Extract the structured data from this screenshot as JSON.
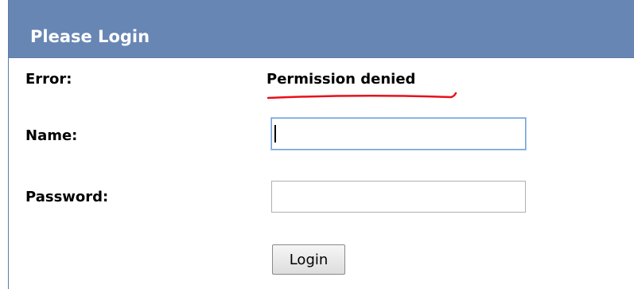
{
  "login_panel": {
    "title": "Please Login",
    "error": {
      "label": "Error:",
      "message": "Permission denied"
    },
    "name": {
      "label": "Name:",
      "value": ""
    },
    "password": {
      "label": "Password:",
      "value": ""
    },
    "submit_label": "Login"
  },
  "colors": {
    "header_background": "#6786b4",
    "header_text": "#ffffff",
    "error_underline": "#e8101a"
  }
}
